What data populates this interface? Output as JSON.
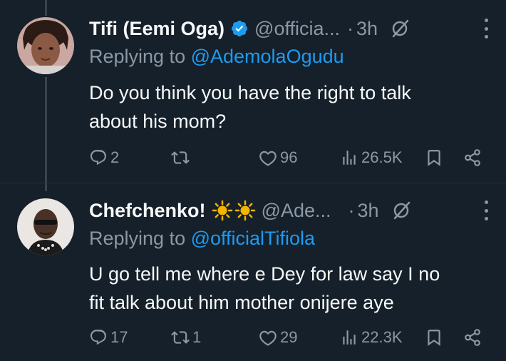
{
  "tweets": [
    {
      "name": "Tifi (Eemi Oga)",
      "verified": true,
      "handle": "@officia...",
      "dot": "·",
      "time": "3h",
      "replying_prefix": "Replying to ",
      "replying_to": "@AdemolaOgudu",
      "text_lines": [
        "Do you think you have the right to talk",
        "about his mom?"
      ],
      "replies": "2",
      "retweets": "",
      "likes": "96",
      "views": "26.5K"
    },
    {
      "name": "Chefchenko!",
      "name_emoji": "☀️☀️",
      "handle": "@Ade...",
      "dot": "·",
      "time": "3h",
      "replying_prefix": "Replying to ",
      "replying_to": "@officialTifiola",
      "text_lines": [
        "U go tell me where e Dey for law say I no",
        "fit talk about him mother onijere aye"
      ],
      "replies": "17",
      "retweets": "1",
      "likes": "29",
      "views": "22.3K"
    }
  ],
  "colors": {
    "background": "#15202b",
    "text": "#f7f9f9",
    "muted": "#8b98a5",
    "link": "#1d9bf0",
    "verified": "#1d9bf0",
    "sun": "#f4b400"
  }
}
